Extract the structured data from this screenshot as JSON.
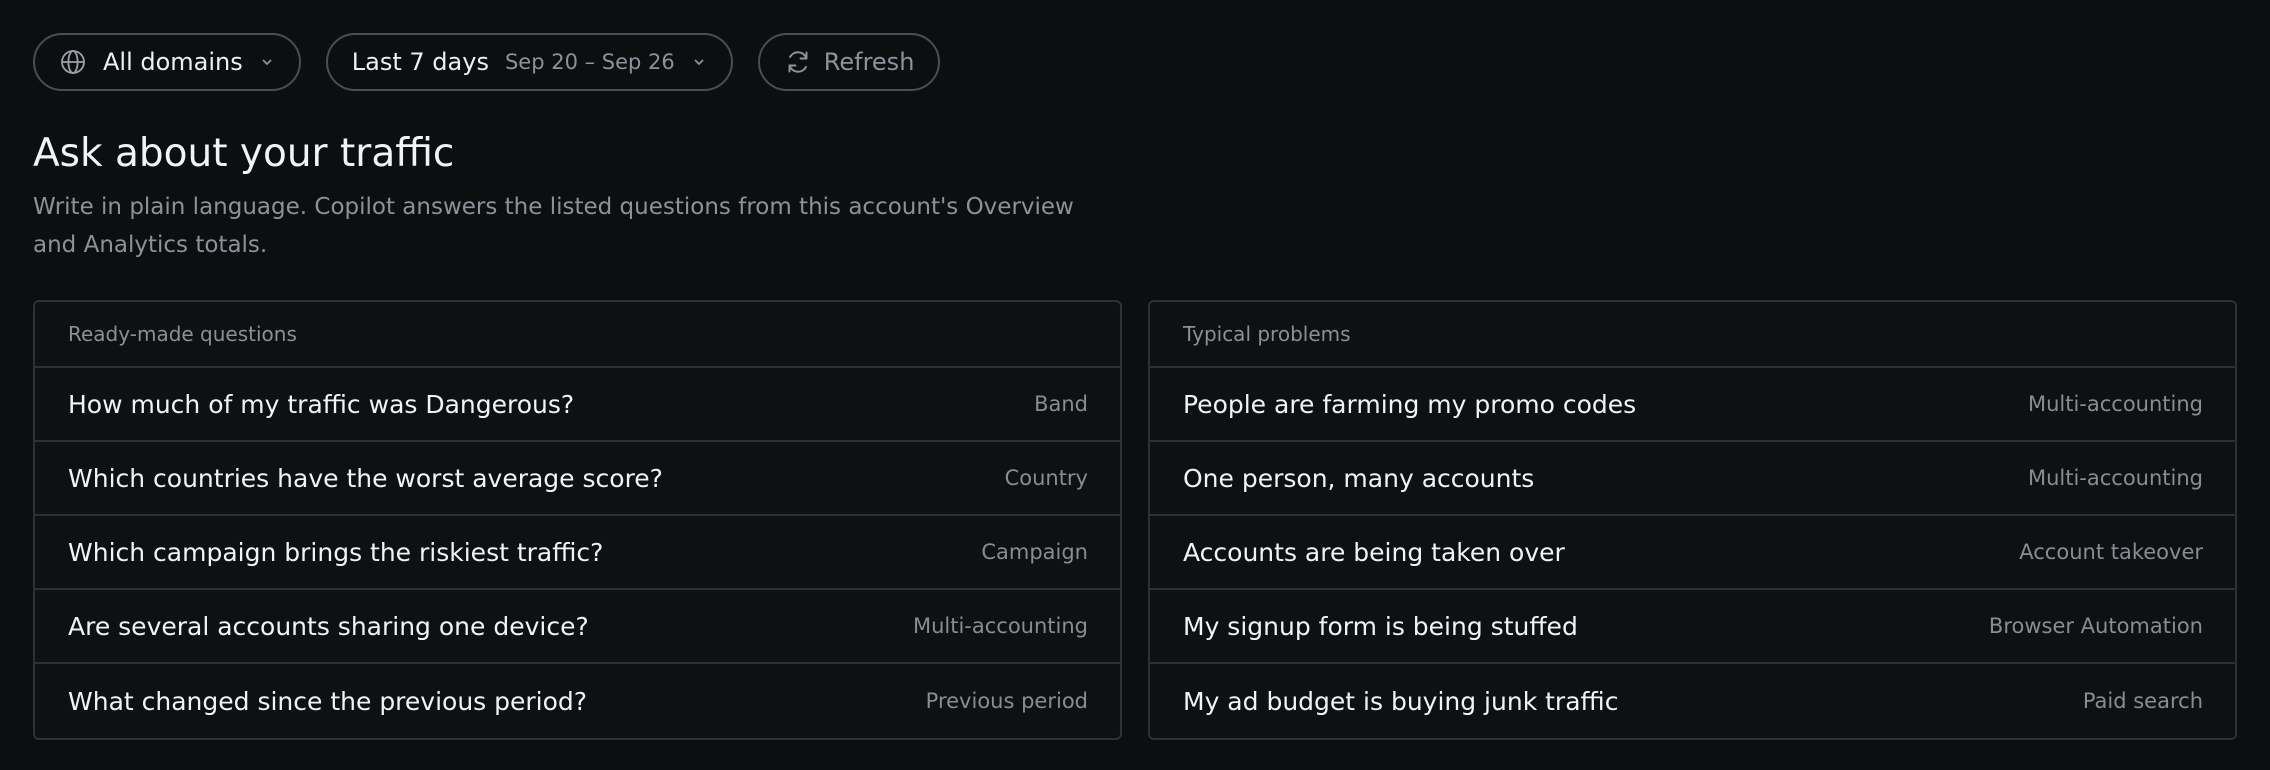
{
  "toolbar": {
    "domains": {
      "label": "All domains",
      "icon": "globe-icon"
    },
    "period": {
      "label": "Last 7 days",
      "range": "Sep 20 – Sep 26"
    },
    "refresh": {
      "label": "Refresh",
      "icon": "refresh-icon"
    }
  },
  "header": {
    "title": "Ask about your traffic",
    "subtitle": "Write in plain language. Copilot answers the listed questions from this account's Overview and Analytics totals."
  },
  "ready_made": {
    "heading": "Ready-made questions",
    "items": [
      {
        "question": "How much of my traffic was Dangerous?",
        "tag": "Band"
      },
      {
        "question": "Which countries have the worst average score?",
        "tag": "Country"
      },
      {
        "question": "Which campaign brings the riskiest traffic?",
        "tag": "Campaign"
      },
      {
        "question": "Are several accounts sharing one device?",
        "tag": "Multi-accounting"
      },
      {
        "question": "What changed since the previous period?",
        "tag": "Previous period"
      }
    ]
  },
  "typical": {
    "heading": "Typical problems",
    "items": [
      {
        "question": "People are farming my promo codes",
        "tag": "Multi-accounting"
      },
      {
        "question": "One person, many accounts",
        "tag": "Multi-accounting"
      },
      {
        "question": "Accounts are being taken over",
        "tag": "Account takeover"
      },
      {
        "question": "My signup form is being stuffed",
        "tag": "Browser Automation"
      },
      {
        "question": "My ad budget is buying junk traffic",
        "tag": "Paid search"
      }
    ]
  },
  "colors": {
    "background": "#0d0e10",
    "border": "#2e3035",
    "text": "#f1f3f5",
    "muted": "#8c919a"
  }
}
